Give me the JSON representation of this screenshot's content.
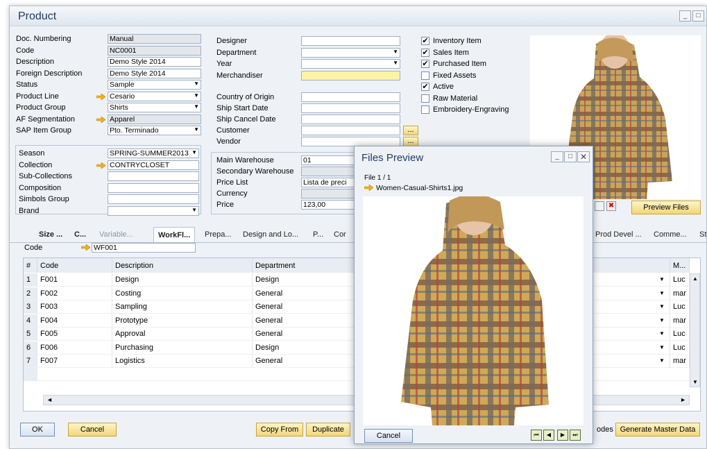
{
  "window": {
    "title": "Product"
  },
  "left_fields": [
    {
      "label": "Doc. Numbering",
      "value": "Manual",
      "readonly": true,
      "dropdown": false,
      "link": false
    },
    {
      "label": "Code",
      "value": "NC0001",
      "readonly": true,
      "dropdown": false,
      "link": false
    },
    {
      "label": "Description",
      "value": "Demo Style 2014",
      "readonly": false,
      "dropdown": false,
      "link": false
    },
    {
      "label": "Foreign Description",
      "value": "Demo Style 2014",
      "readonly": false,
      "dropdown": false,
      "link": false
    },
    {
      "label": "Status",
      "value": "Sample",
      "readonly": false,
      "dropdown": true,
      "link": false
    },
    {
      "label": "Product Line",
      "value": "Cesario",
      "readonly": false,
      "dropdown": true,
      "link": true
    },
    {
      "label": "Product Group",
      "value": "Shirts",
      "readonly": false,
      "dropdown": true,
      "link": false
    },
    {
      "label": "AF Segmentation",
      "value": "Apparel",
      "readonly": true,
      "dropdown": false,
      "link": true
    },
    {
      "label": "SAP Item Group",
      "value": "Pto. Terminado",
      "readonly": false,
      "dropdown": true,
      "link": false
    }
  ],
  "season_fields": [
    {
      "label": "Season",
      "value": "SPRING-SUMMER2013",
      "dropdown": true,
      "link": false
    },
    {
      "label": "Collection",
      "value": "CONTRYCLOSET",
      "dropdown": false,
      "link": true
    },
    {
      "label": "Sub-Collections",
      "value": "",
      "dropdown": false,
      "link": false
    },
    {
      "label": "Composition",
      "value": "",
      "dropdown": false,
      "link": false
    },
    {
      "label": "Simbols Group",
      "value": "",
      "dropdown": false,
      "link": false
    },
    {
      "label": "Brand",
      "value": "",
      "dropdown": true,
      "link": false
    }
  ],
  "mid_fields": [
    {
      "label": "Designer",
      "value": "",
      "style": "plain",
      "dropdown": false
    },
    {
      "label": "Department",
      "value": "",
      "style": "plain",
      "dropdown": true
    },
    {
      "label": "Year",
      "value": "",
      "style": "plain",
      "dropdown": true
    },
    {
      "label": "Merchandiser",
      "value": "",
      "style": "yellow",
      "dropdown": false
    }
  ],
  "origin_fields": [
    {
      "label": "Country of Origin",
      "value": ""
    },
    {
      "label": "Ship Start Date",
      "value": ""
    },
    {
      "label": "Ship Cancel Date",
      "value": ""
    },
    {
      "label": "Customer",
      "value": ""
    },
    {
      "label": "Vendor",
      "value": ""
    }
  ],
  "warehouse_fields": [
    {
      "label": "Main Warehouse",
      "value": "01"
    },
    {
      "label": "Secondary Warehouse",
      "value": ""
    },
    {
      "label": "Price List",
      "value": "Lista de preci"
    },
    {
      "label": "Currency",
      "value": ""
    },
    {
      "label": "Price",
      "value": "123,00"
    }
  ],
  "browse_button": "...",
  "checkboxes": [
    {
      "label": "Inventory Item",
      "checked": true
    },
    {
      "label": "Sales Item",
      "checked": true
    },
    {
      "label": "Purchased Item",
      "checked": true
    },
    {
      "label": "Fixed Assets",
      "checked": false
    },
    {
      "label": "Active",
      "checked": true
    },
    {
      "label": "Raw Material",
      "checked": false
    },
    {
      "label": "Embroidery-Engraving",
      "checked": false
    }
  ],
  "preview_files_button": "Preview Files",
  "tabs": [
    "Size ...",
    "C...",
    "Variable...",
    "WorkFl...",
    "Prepa...",
    "Design and Lo...",
    "P...",
    "Cor",
    "Prod Devel ...",
    "Comme...",
    "St"
  ],
  "workflow": {
    "code_label": "Code",
    "code_value": "WF001"
  },
  "grid": {
    "columns": [
      "#",
      "Code",
      "Description",
      "Department",
      "M..."
    ],
    "rows": [
      {
        "n": "1",
        "code": "F001",
        "description": "Design",
        "department": "Design",
        "m": "Luc"
      },
      {
        "n": "2",
        "code": "F002",
        "description": "Costing",
        "department": "General",
        "m": "mar"
      },
      {
        "n": "3",
        "code": "F003",
        "description": "Sampling",
        "department": "General",
        "m": "Luc"
      },
      {
        "n": "4",
        "code": "F004",
        "description": "Prototype",
        "department": "General",
        "m": "mar"
      },
      {
        "n": "5",
        "code": "F005",
        "description": "Approval",
        "department": "General",
        "m": "Luc"
      },
      {
        "n": "6",
        "code": "F006",
        "description": "Purchasing",
        "department": "Design",
        "m": "Luc"
      },
      {
        "n": "7",
        "code": "F007",
        "description": "Logistics",
        "department": "General",
        "m": "mar"
      }
    ]
  },
  "footer": {
    "ok": "OK",
    "cancel": "Cancel",
    "copy_from": "Copy From",
    "duplicate": "Duplicate",
    "codes_label": "odes",
    "generate": "Generate Master Data"
  },
  "preview": {
    "title": "Files Preview",
    "file_count": "File 1 / 1",
    "file_name": "Women-Casual-Shirts1.jpg",
    "cancel": "Cancel"
  },
  "colors": {
    "accent": "#1f3b63",
    "button_yellow": "#f2d67a",
    "link_arrow": "#f0b21a"
  }
}
